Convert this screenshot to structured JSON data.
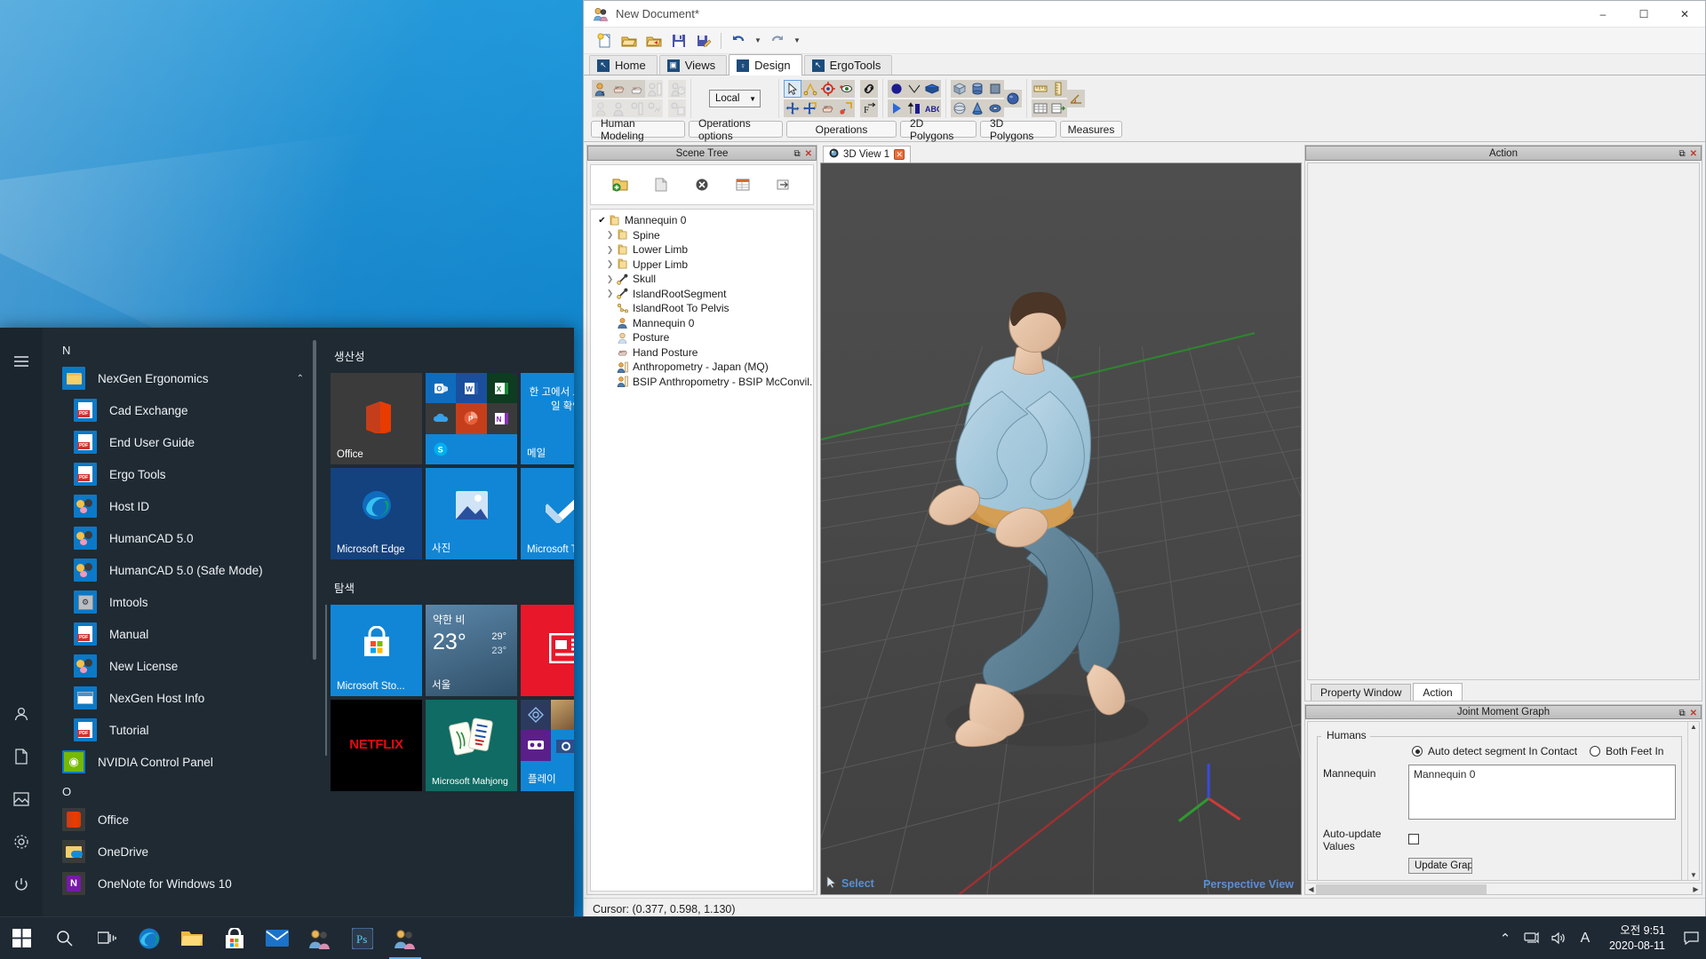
{
  "app": {
    "title": "New Document*",
    "window_buttons": {
      "minimize": "–",
      "maximize": "☐",
      "close": "✕"
    },
    "ribbon_tabs": [
      {
        "label": "Home",
        "icon": "arrow-cursor-icon",
        "active": false
      },
      {
        "label": "Views",
        "icon": "camera-icon",
        "active": false
      },
      {
        "label": "Design",
        "icon": "bulb-icon",
        "active": true
      },
      {
        "label": "ErgoTools",
        "icon": "arrow-cursor-icon",
        "active": false
      }
    ],
    "coordinate_system": "Local",
    "group_labels": [
      "Human Modeling",
      "Operations options",
      "Operations",
      "2D Polygons",
      "3D Polygons",
      "Measures"
    ],
    "status_bar": "Cursor: (0.377, 0.598, 1.130)"
  },
  "scene_tree": {
    "panel_title": "Scene Tree",
    "items": [
      {
        "label": "Mannequin 0",
        "marker": "check",
        "icon": "folder-icon",
        "indent": 0
      },
      {
        "label": "Spine",
        "marker": "chevron",
        "icon": "folder-icon",
        "indent": 1
      },
      {
        "label": "Lower Limb",
        "marker": "chevron",
        "icon": "folder-icon",
        "indent": 1
      },
      {
        "label": "Upper Limb",
        "marker": "chevron",
        "icon": "folder-icon",
        "indent": 1
      },
      {
        "label": "Skull",
        "marker": "chevron",
        "icon": "bone-icon",
        "indent": 1
      },
      {
        "label": "IslandRootSegment",
        "marker": "chevron",
        "icon": "bone-icon",
        "indent": 1
      },
      {
        "label": "IslandRoot To Pelvis",
        "marker": "none",
        "icon": "link-icon",
        "indent": 1
      },
      {
        "label": "Mannequin 0",
        "marker": "none",
        "icon": "mannequin-icon",
        "indent": 1
      },
      {
        "label": "Posture",
        "marker": "none",
        "icon": "posture-icon",
        "indent": 1
      },
      {
        "label": "Hand Posture",
        "marker": "none",
        "icon": "hand-icon",
        "indent": 1
      },
      {
        "label": "Anthropometry - Japan (MQ)",
        "marker": "none",
        "icon": "anthro-icon",
        "indent": 1
      },
      {
        "label": "BSIP Anthropometry - BSIP McConvil...",
        "marker": "none",
        "icon": "anthro-icon",
        "indent": 1
      }
    ]
  },
  "viewport": {
    "tab_label": "3D View 1",
    "tab_close": "✕",
    "mode_label": "Select",
    "projection_label": "Perspective View"
  },
  "right_dock": {
    "action_panel_title": "Action",
    "tabs": [
      {
        "label": "Property Window",
        "active": false
      },
      {
        "label": "Action",
        "active": true
      }
    ],
    "joint_moment_graph": {
      "title": "Joint Moment Graph",
      "group_label": "Humans",
      "radio_options": [
        {
          "label": "Auto detect segment In Contact",
          "selected": true
        },
        {
          "label": "Both Feet In",
          "selected": false
        }
      ],
      "mannequin_label": "Mannequin",
      "mannequin_value": "Mannequin 0",
      "auto_update_label": "Auto-update Values",
      "auto_update_checked": false,
      "update_button": "Update Graph"
    }
  },
  "start_menu": {
    "rail": [
      {
        "icon": "hamburger-icon",
        "name": "menu"
      },
      {
        "icon": "user-icon",
        "name": "account"
      },
      {
        "icon": "document-icon",
        "name": "documents"
      },
      {
        "icon": "pictures-icon",
        "name": "pictures"
      },
      {
        "icon": "gear-icon",
        "name": "settings"
      },
      {
        "icon": "power-icon",
        "name": "power"
      }
    ],
    "letter_sections": [
      {
        "letter": "N"
      },
      {
        "letter": "O"
      }
    ],
    "apps": [
      {
        "label": "NexGen Ergonomics",
        "icon": "folder",
        "sub": false,
        "expander": "⌃"
      },
      {
        "label": "Cad Exchange",
        "icon": "pdf",
        "sub": true
      },
      {
        "label": "End User Guide",
        "icon": "pdf",
        "sub": true
      },
      {
        "label": "Ergo Tools",
        "icon": "pdf",
        "sub": true
      },
      {
        "label": "Host ID",
        "icon": "people",
        "sub": true
      },
      {
        "label": "HumanCAD 5.0",
        "icon": "people",
        "sub": true
      },
      {
        "label": "HumanCAD 5.0 (Safe Mode)",
        "icon": "people",
        "sub": true
      },
      {
        "label": "Imtools",
        "icon": "gray",
        "sub": true
      },
      {
        "label": "Manual",
        "icon": "pdf",
        "sub": true
      },
      {
        "label": "New License",
        "icon": "people",
        "sub": true
      },
      {
        "label": "NexGen Host Info",
        "icon": "win",
        "sub": true
      },
      {
        "label": "Tutorial",
        "icon": "pdf",
        "sub": true
      },
      {
        "label": "NVIDIA Control Panel",
        "icon": "nvidia",
        "sub": false
      }
    ],
    "apps_after_o": [
      {
        "label": "Office",
        "icon": "office",
        "sub": false
      },
      {
        "label": "OneDrive",
        "icon": "onedrive",
        "sub": false
      },
      {
        "label": "OneNote for Windows 10",
        "icon": "onenote",
        "sub": false
      }
    ],
    "tile_groups": [
      {
        "title": "생산성",
        "tiles": [
          {
            "name": "Office",
            "label": "Office",
            "size": "m",
            "color": "#3b3b3b"
          },
          {
            "name": "office-cluster",
            "label": "",
            "size": "m",
            "color": "#0e5ca8"
          },
          {
            "name": "Mail",
            "label": "메일",
            "headline": "한 고에서 모든 메일 확인",
            "size": "m",
            "color": "#1186d6"
          },
          {
            "name": "Microsoft Edge",
            "label": "Microsoft Edge",
            "size": "m",
            "color": "#14427e"
          },
          {
            "name": "Photos",
            "label": "사진",
            "size": "m",
            "color": "#1186d6"
          },
          {
            "name": "Microsoft To Do",
            "label": "Microsoft To...",
            "size": "m",
            "color": "#1186d6"
          }
        ]
      },
      {
        "title": "탐색",
        "tiles": [
          {
            "name": "Microsoft Store",
            "label": "Microsoft Sto...",
            "size": "m",
            "color": "#1186d6"
          },
          {
            "name": "Weather",
            "label": "서울",
            "headline": "약한 비",
            "temp": "23°",
            "high": "29°",
            "low": "23°",
            "size": "m",
            "color": "#3d6f96"
          },
          {
            "name": "News",
            "label": "",
            "size": "m",
            "color": "#e8172a"
          },
          {
            "name": "Netflix",
            "label": "NETFLIX",
            "size": "m",
            "color": "#000000"
          },
          {
            "name": "Microsoft Mahjong",
            "label": "Microsoft Mahjong",
            "size": "m",
            "color": "#0f6b63"
          },
          {
            "name": "Play",
            "label": "플레이",
            "size": "m",
            "color": "#1186d6"
          }
        ]
      }
    ]
  },
  "taskbar": {
    "apps": [
      {
        "name": "start",
        "icon": "windows-logo-icon"
      },
      {
        "name": "search",
        "icon": "search-icon"
      },
      {
        "name": "task-view",
        "icon": "task-view-icon"
      },
      {
        "name": "edge",
        "icon": "edge-icon"
      },
      {
        "name": "file-explorer",
        "icon": "folder-icon"
      },
      {
        "name": "store",
        "icon": "store-icon"
      },
      {
        "name": "mail",
        "icon": "mail-icon"
      },
      {
        "name": "humancad",
        "icon": "humancad-icon"
      },
      {
        "name": "photoshop",
        "icon": "app-icon"
      },
      {
        "name": "humancad-running",
        "icon": "humancad-icon"
      }
    ],
    "tray": {
      "chevron": "⌃",
      "network": "network-icon",
      "volume": "volume-icon",
      "ime": "A",
      "time": "오전 9:51",
      "date": "2020-08-11",
      "notifications": "notification-icon"
    }
  }
}
